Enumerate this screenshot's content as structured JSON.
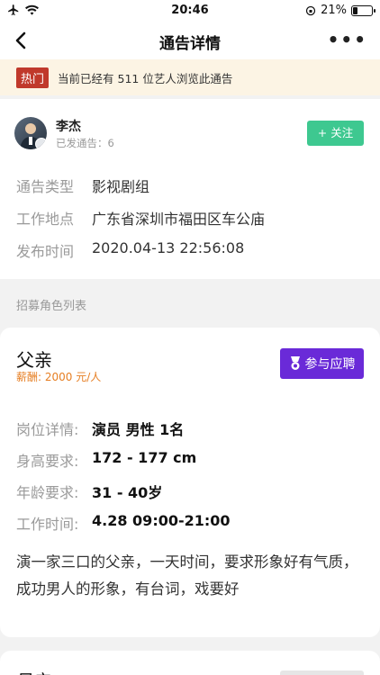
{
  "status_bar": {
    "time": "20:46",
    "battery": "21%",
    "battery_level": 0.21
  },
  "nav": {
    "title": "通告详情",
    "more": "•••"
  },
  "notice": {
    "tag": "热门",
    "text": "当前已经有 511 位艺人浏览此通告"
  },
  "profile": {
    "name": "李杰",
    "posted": "已发通告：6",
    "follow_label": "+ 关注"
  },
  "info": [
    {
      "key": "通告类型",
      "value": "影视剧组"
    },
    {
      "key": "工作地点",
      "value": "广东省深圳市福田区车公庙"
    },
    {
      "key": "发布时间",
      "value": "2020.04-13 22:56:08"
    }
  ],
  "section_label": "招募角色列表",
  "role": {
    "title": "父亲",
    "salary": "薪酬: 2000 元/人",
    "apply_label": "参与应聘",
    "requirements": [
      {
        "key": "岗位详情:",
        "value": "演员 男性 1名"
      },
      {
        "key": "身高要求:",
        "value": "172 - 177 cm"
      },
      {
        "key": "年龄要求:",
        "value": "31 - 40岁"
      },
      {
        "key": "工作时间:",
        "value": "4.28 09:00-21:00"
      }
    ],
    "description": "演一家三口的父亲，一天时间，要求形象好有气质，成功男人的形象，有台词，戏要好"
  },
  "next_role": {
    "title": "母亲"
  }
}
